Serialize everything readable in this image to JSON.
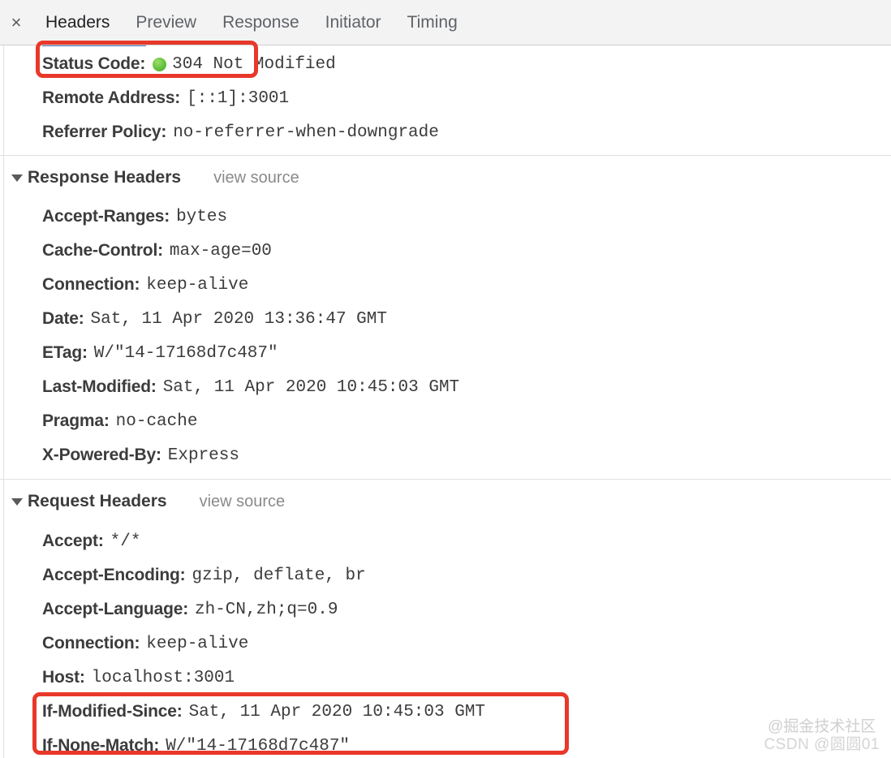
{
  "tabbar": {
    "close_label": "×",
    "close_icon": "close-icon",
    "tabs": [
      {
        "label": "Headers",
        "active": true
      },
      {
        "label": "Preview",
        "active": false
      },
      {
        "label": "Response",
        "active": false
      },
      {
        "label": "Initiator",
        "active": false
      },
      {
        "label": "Timing",
        "active": false
      }
    ]
  },
  "colors": {
    "accent_blue": "#4a6fb5",
    "annotation_red": "#e8382a",
    "status_green": "#63c13c",
    "tabbar_bg": "#f3f3f3",
    "divider": "#e0e0e0"
  },
  "general": {
    "rows": [
      {
        "key": "Status Code:",
        "value": "304 Not Modified",
        "has_status_dot": true
      },
      {
        "key": "Remote Address:",
        "value": "[::1]:3001",
        "has_status_dot": false
      },
      {
        "key": "Referrer Policy:",
        "value": "no-referrer-when-downgrade",
        "has_status_dot": false
      }
    ]
  },
  "response_headers": {
    "title": "Response Headers",
    "view_source": "view source",
    "expanded": true,
    "rows": [
      {
        "key": "Accept-Ranges:",
        "value": "bytes"
      },
      {
        "key": "Cache-Control:",
        "value": "max-age=00"
      },
      {
        "key": "Connection:",
        "value": "keep-alive"
      },
      {
        "key": "Date:",
        "value": "Sat, 11 Apr 2020 13:36:47 GMT"
      },
      {
        "key": "ETag:",
        "value": "W/\"14-17168d7c487\""
      },
      {
        "key": "Last-Modified:",
        "value": "Sat, 11 Apr 2020 10:45:03 GMT"
      },
      {
        "key": "Pragma:",
        "value": "no-cache"
      },
      {
        "key": "X-Powered-By:",
        "value": "Express"
      }
    ]
  },
  "request_headers": {
    "title": "Request Headers",
    "view_source": "view source",
    "expanded": true,
    "rows": [
      {
        "key": "Accept:",
        "value": "*/*"
      },
      {
        "key": "Accept-Encoding:",
        "value": "gzip, deflate, br"
      },
      {
        "key": "Accept-Language:",
        "value": "zh-CN,zh;q=0.9"
      },
      {
        "key": "Connection:",
        "value": "keep-alive"
      },
      {
        "key": "Host:",
        "value": "localhost:3001"
      },
      {
        "key": "If-Modified-Since:",
        "value": "Sat, 11 Apr 2020 10:45:03 GMT"
      },
      {
        "key": "If-None-Match:",
        "value": "W/\"14-17168d7c487\""
      }
    ]
  },
  "annotations": [
    {
      "name": "status-code-highlight",
      "target": "Status Code:"
    },
    {
      "name": "if-modified-since-highlight",
      "target": "If-Modified-Since:"
    }
  ],
  "watermark": {
    "line1": "@掘金技术社区",
    "line2": "CSDN @圆圆01"
  }
}
